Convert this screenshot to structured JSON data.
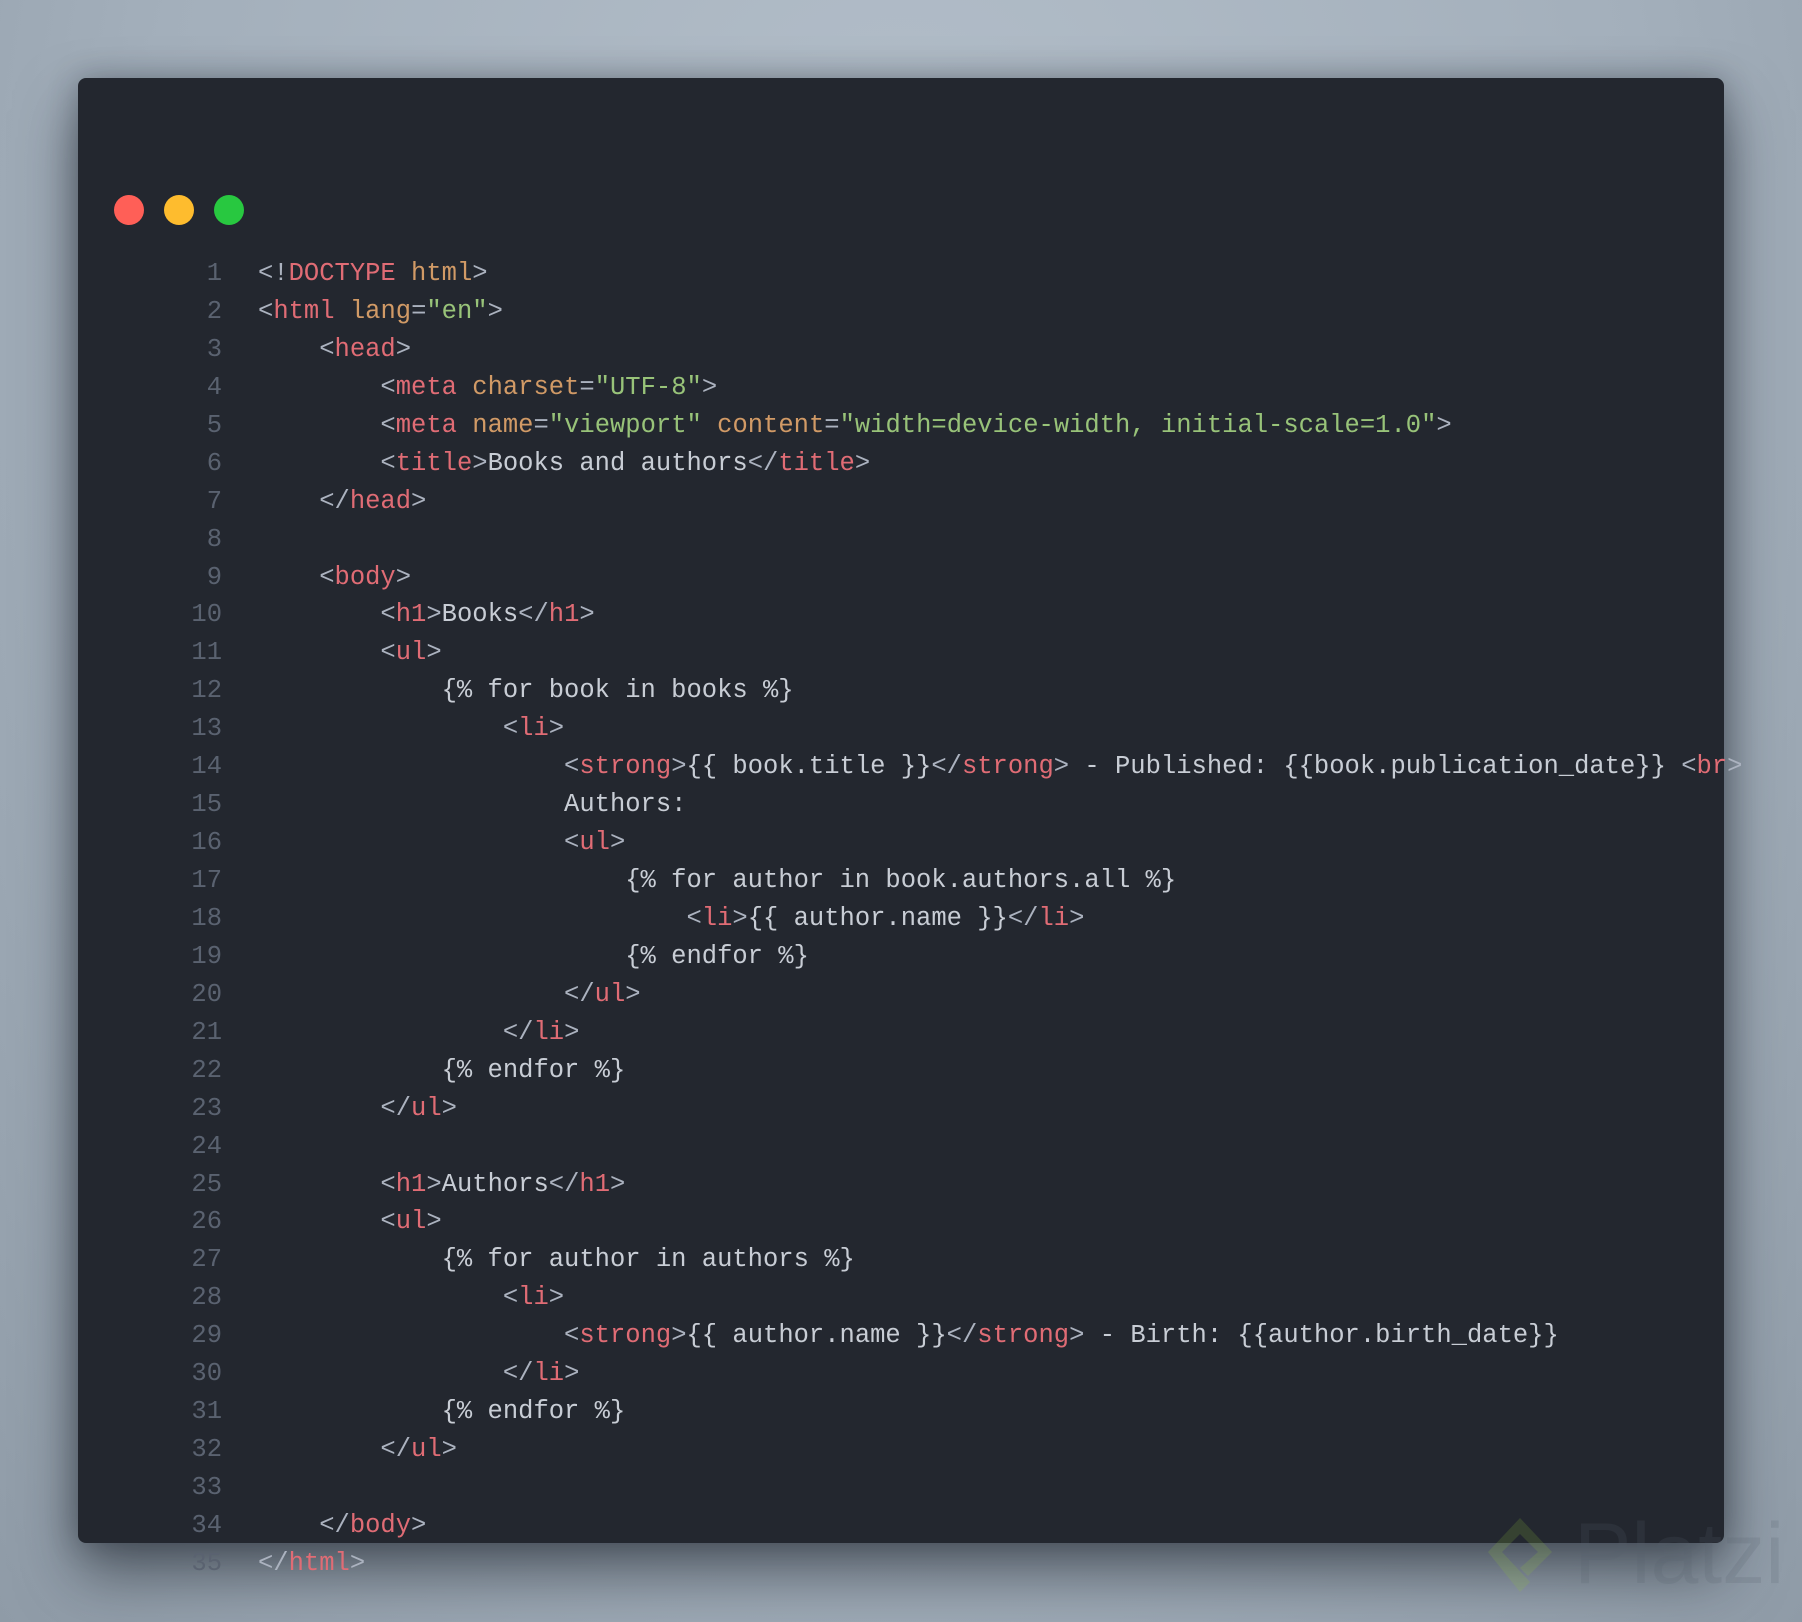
{
  "window": {
    "controls": [
      {
        "name": "close",
        "color": "#ff5f57"
      },
      {
        "name": "minimize",
        "color": "#febc2e"
      },
      {
        "name": "maximize",
        "color": "#28c840"
      }
    ]
  },
  "colors": {
    "tag": "#e06c75",
    "attribute": "#d19a66",
    "string": "#98c379",
    "text": "#abb2bf",
    "background": "#23272f"
  },
  "watermark": "Platzi",
  "lines": [
    {
      "n": "1",
      "tokens": [
        {
          "c": "p",
          "t": "<!"
        },
        {
          "c": "t",
          "t": "DOCTYPE"
        },
        {
          "c": "p",
          "t": " "
        },
        {
          "c": "a",
          "t": "html"
        },
        {
          "c": "p",
          "t": ">"
        }
      ]
    },
    {
      "n": "2",
      "tokens": [
        {
          "c": "p",
          "t": "<"
        },
        {
          "c": "t",
          "t": "html"
        },
        {
          "c": "p",
          "t": " "
        },
        {
          "c": "a",
          "t": "lang"
        },
        {
          "c": "p",
          "t": "="
        },
        {
          "c": "s",
          "t": "\"en\""
        },
        {
          "c": "p",
          "t": ">"
        }
      ]
    },
    {
      "n": "3",
      "tokens": [
        {
          "c": "p",
          "t": "    <"
        },
        {
          "c": "t",
          "t": "head"
        },
        {
          "c": "p",
          "t": ">"
        }
      ]
    },
    {
      "n": "4",
      "tokens": [
        {
          "c": "p",
          "t": "        <"
        },
        {
          "c": "t",
          "t": "meta"
        },
        {
          "c": "p",
          "t": " "
        },
        {
          "c": "a",
          "t": "charset"
        },
        {
          "c": "p",
          "t": "="
        },
        {
          "c": "s",
          "t": "\"UTF-8\""
        },
        {
          "c": "p",
          "t": ">"
        }
      ]
    },
    {
      "n": "5",
      "tokens": [
        {
          "c": "p",
          "t": "        <"
        },
        {
          "c": "t",
          "t": "meta"
        },
        {
          "c": "p",
          "t": " "
        },
        {
          "c": "a",
          "t": "name"
        },
        {
          "c": "p",
          "t": "="
        },
        {
          "c": "s",
          "t": "\"viewport\""
        },
        {
          "c": "p",
          "t": " "
        },
        {
          "c": "a",
          "t": "content"
        },
        {
          "c": "p",
          "t": "="
        },
        {
          "c": "s",
          "t": "\"width=device-width, initial-scale=1.0\""
        },
        {
          "c": "p",
          "t": ">"
        }
      ]
    },
    {
      "n": "6",
      "tokens": [
        {
          "c": "p",
          "t": "        <"
        },
        {
          "c": "t",
          "t": "title"
        },
        {
          "c": "p",
          "t": ">"
        },
        {
          "c": "x",
          "t": "Books and authors"
        },
        {
          "c": "p",
          "t": "</"
        },
        {
          "c": "t",
          "t": "title"
        },
        {
          "c": "p",
          "t": ">"
        }
      ]
    },
    {
      "n": "7",
      "tokens": [
        {
          "c": "p",
          "t": "    </"
        },
        {
          "c": "t",
          "t": "head"
        },
        {
          "c": "p",
          "t": ">"
        }
      ]
    },
    {
      "n": "8",
      "tokens": []
    },
    {
      "n": "9",
      "tokens": [
        {
          "c": "p",
          "t": "    <"
        },
        {
          "c": "t",
          "t": "body"
        },
        {
          "c": "p",
          "t": ">"
        }
      ]
    },
    {
      "n": "10",
      "tokens": [
        {
          "c": "p",
          "t": "        <"
        },
        {
          "c": "t",
          "t": "h1"
        },
        {
          "c": "p",
          "t": ">"
        },
        {
          "c": "x",
          "t": "Books"
        },
        {
          "c": "p",
          "t": "</"
        },
        {
          "c": "t",
          "t": "h1"
        },
        {
          "c": "p",
          "t": ">"
        }
      ]
    },
    {
      "n": "11",
      "tokens": [
        {
          "c": "p",
          "t": "        <"
        },
        {
          "c": "t",
          "t": "ul"
        },
        {
          "c": "p",
          "t": ">"
        }
      ]
    },
    {
      "n": "12",
      "tokens": [
        {
          "c": "x",
          "t": "            {% for book in books %}"
        }
      ]
    },
    {
      "n": "13",
      "tokens": [
        {
          "c": "p",
          "t": "                <"
        },
        {
          "c": "t",
          "t": "li"
        },
        {
          "c": "p",
          "t": ">"
        }
      ]
    },
    {
      "n": "14",
      "tokens": [
        {
          "c": "p",
          "t": "                    <"
        },
        {
          "c": "t",
          "t": "strong"
        },
        {
          "c": "p",
          "t": ">"
        },
        {
          "c": "x",
          "t": "{{ book.title }}"
        },
        {
          "c": "p",
          "t": "</"
        },
        {
          "c": "t",
          "t": "strong"
        },
        {
          "c": "p",
          "t": ">"
        },
        {
          "c": "x",
          "t": " - Published: {{book.publication_date}} "
        },
        {
          "c": "p",
          "t": "<"
        },
        {
          "c": "t",
          "t": "br"
        },
        {
          "c": "p",
          "t": ">"
        }
      ]
    },
    {
      "n": "15",
      "tokens": [
        {
          "c": "x",
          "t": "                    Authors:"
        }
      ]
    },
    {
      "n": "16",
      "tokens": [
        {
          "c": "p",
          "t": "                    <"
        },
        {
          "c": "t",
          "t": "ul"
        },
        {
          "c": "p",
          "t": ">"
        }
      ]
    },
    {
      "n": "17",
      "tokens": [
        {
          "c": "x",
          "t": "                        {% for author in book.authors.all %}"
        }
      ]
    },
    {
      "n": "18",
      "tokens": [
        {
          "c": "p",
          "t": "                            <"
        },
        {
          "c": "t",
          "t": "li"
        },
        {
          "c": "p",
          "t": ">"
        },
        {
          "c": "x",
          "t": "{{ author.name }}"
        },
        {
          "c": "p",
          "t": "</"
        },
        {
          "c": "t",
          "t": "li"
        },
        {
          "c": "p",
          "t": ">"
        }
      ]
    },
    {
      "n": "19",
      "tokens": [
        {
          "c": "x",
          "t": "                        {% endfor %}"
        }
      ]
    },
    {
      "n": "20",
      "tokens": [
        {
          "c": "p",
          "t": "                    </"
        },
        {
          "c": "t",
          "t": "ul"
        },
        {
          "c": "p",
          "t": ">"
        }
      ]
    },
    {
      "n": "21",
      "tokens": [
        {
          "c": "p",
          "t": "                </"
        },
        {
          "c": "t",
          "t": "li"
        },
        {
          "c": "p",
          "t": ">"
        }
      ]
    },
    {
      "n": "22",
      "tokens": [
        {
          "c": "x",
          "t": "            {% endfor %}"
        }
      ]
    },
    {
      "n": "23",
      "tokens": [
        {
          "c": "p",
          "t": "        </"
        },
        {
          "c": "t",
          "t": "ul"
        },
        {
          "c": "p",
          "t": ">"
        }
      ]
    },
    {
      "n": "24",
      "tokens": []
    },
    {
      "n": "25",
      "tokens": [
        {
          "c": "p",
          "t": "        <"
        },
        {
          "c": "t",
          "t": "h1"
        },
        {
          "c": "p",
          "t": ">"
        },
        {
          "c": "x",
          "t": "Authors"
        },
        {
          "c": "p",
          "t": "</"
        },
        {
          "c": "t",
          "t": "h1"
        },
        {
          "c": "p",
          "t": ">"
        }
      ]
    },
    {
      "n": "26",
      "tokens": [
        {
          "c": "p",
          "t": "        <"
        },
        {
          "c": "t",
          "t": "ul"
        },
        {
          "c": "p",
          "t": ">"
        }
      ]
    },
    {
      "n": "27",
      "tokens": [
        {
          "c": "x",
          "t": "            {% for author in authors %}"
        }
      ]
    },
    {
      "n": "28",
      "tokens": [
        {
          "c": "p",
          "t": "                <"
        },
        {
          "c": "t",
          "t": "li"
        },
        {
          "c": "p",
          "t": ">"
        }
      ]
    },
    {
      "n": "29",
      "tokens": [
        {
          "c": "p",
          "t": "                    <"
        },
        {
          "c": "t",
          "t": "strong"
        },
        {
          "c": "p",
          "t": ">"
        },
        {
          "c": "x",
          "t": "{{ author.name }}"
        },
        {
          "c": "p",
          "t": "</"
        },
        {
          "c": "t",
          "t": "strong"
        },
        {
          "c": "p",
          "t": ">"
        },
        {
          "c": "x",
          "t": " - Birth: {{author.birth_date}}"
        }
      ]
    },
    {
      "n": "30",
      "tokens": [
        {
          "c": "p",
          "t": "                </"
        },
        {
          "c": "t",
          "t": "li"
        },
        {
          "c": "p",
          "t": ">"
        }
      ]
    },
    {
      "n": "31",
      "tokens": [
        {
          "c": "x",
          "t": "            {% endfor %}"
        }
      ]
    },
    {
      "n": "32",
      "tokens": [
        {
          "c": "p",
          "t": "        </"
        },
        {
          "c": "t",
          "t": "ul"
        },
        {
          "c": "p",
          "t": ">"
        }
      ]
    },
    {
      "n": "33",
      "tokens": []
    },
    {
      "n": "34",
      "tokens": [
        {
          "c": "p",
          "t": "    </"
        },
        {
          "c": "t",
          "t": "body"
        },
        {
          "c": "p",
          "t": ">"
        }
      ]
    },
    {
      "n": "35",
      "tokens": [
        {
          "c": "p",
          "t": "</"
        },
        {
          "c": "t",
          "t": "html"
        },
        {
          "c": "p",
          "t": ">"
        }
      ]
    }
  ]
}
